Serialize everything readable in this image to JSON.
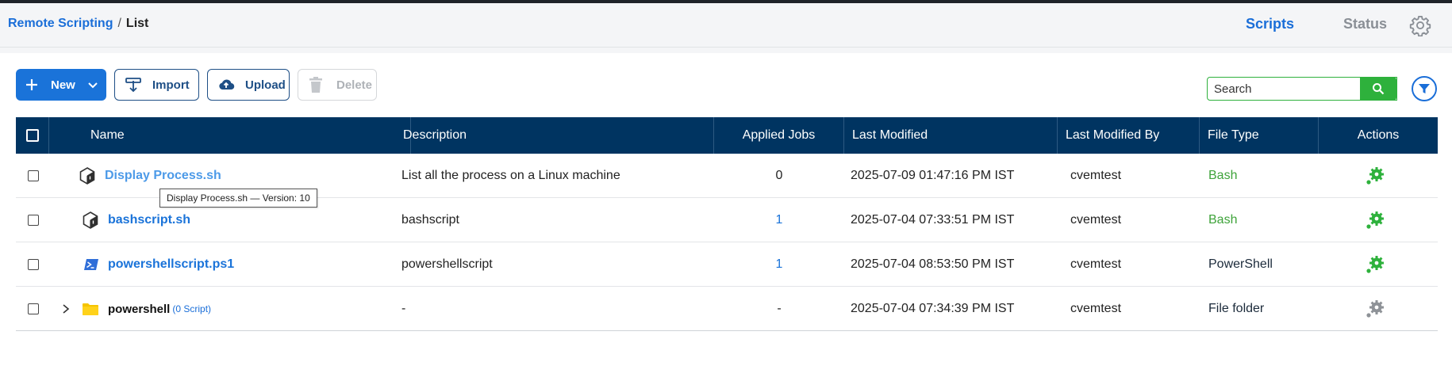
{
  "breadcrumb": {
    "root": "Remote Scripting",
    "separator": "/",
    "current": "List"
  },
  "header_tabs": {
    "scripts": "Scripts",
    "status": "Status"
  },
  "toolbar": {
    "new_label": "New",
    "import_label": "Import",
    "upload_label": "Upload",
    "delete_label": "Delete"
  },
  "search": {
    "placeholder": "Search"
  },
  "table": {
    "columns": [
      "Name",
      "Description",
      "Applied Jobs",
      "Last Modified",
      "Last Modified By",
      "File Type",
      "Actions"
    ],
    "rows": [
      {
        "name": "Display Process.sh",
        "description": "List all the process on a Linux machine",
        "applied_jobs": "0",
        "last_modified": "2025-07-09 01:47:16 PM IST",
        "modified_by": "cvemtest",
        "file_type": "Bash",
        "icon": "bash-script-icon"
      },
      {
        "name": "bashscript.sh",
        "description": "bashscript",
        "applied_jobs": "1",
        "last_modified": "2025-07-04 07:33:51 PM IST",
        "modified_by": "cvemtest",
        "file_type": "Bash",
        "icon": "bash-script-icon"
      },
      {
        "name": "powershellscript.ps1",
        "description": "powershellscript",
        "applied_jobs": "1",
        "last_modified": "2025-07-04 08:53:50 PM IST",
        "modified_by": "cvemtest",
        "file_type": "PowerShell",
        "icon": "powershell-script-icon"
      },
      {
        "name": "powershell",
        "count": "(0 Script)",
        "description": "-",
        "applied_jobs": "-",
        "last_modified": "2025-07-04 07:34:39 PM IST",
        "modified_by": "cvemtest",
        "file_type": "File folder",
        "icon": "folder-icon"
      }
    ]
  },
  "tooltip": {
    "text": "Display Process.sh — Version: 10"
  },
  "colors": {
    "brand_blue": "#1a73d9",
    "header_navy": "#003461",
    "success_green": "#2eb13c",
    "bash_green": "#3ea33a"
  }
}
